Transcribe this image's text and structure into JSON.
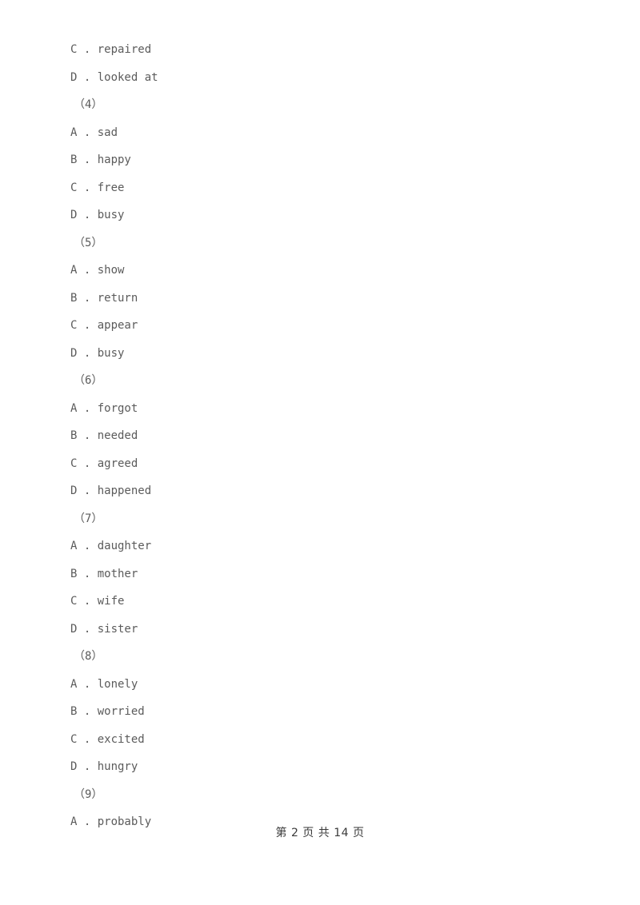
{
  "document": {
    "page_background": "#ffffff",
    "text_color": "#5b5b5b",
    "footer_color": "#3a3a3a"
  },
  "lines": [
    {
      "type": "option",
      "text": "C . repaired"
    },
    {
      "type": "option",
      "text": "D . looked at"
    },
    {
      "type": "qnum",
      "text": "（4）"
    },
    {
      "type": "option",
      "text": "A . sad"
    },
    {
      "type": "option",
      "text": "B . happy"
    },
    {
      "type": "option",
      "text": "C . free"
    },
    {
      "type": "option",
      "text": "D . busy"
    },
    {
      "type": "qnum",
      "text": "（5）"
    },
    {
      "type": "option",
      "text": "A . show"
    },
    {
      "type": "option",
      "text": "B . return"
    },
    {
      "type": "option",
      "text": "C . appear"
    },
    {
      "type": "option",
      "text": "D . busy"
    },
    {
      "type": "qnum",
      "text": "（6）"
    },
    {
      "type": "option",
      "text": "A . forgot"
    },
    {
      "type": "option",
      "text": "B . needed"
    },
    {
      "type": "option",
      "text": "C . agreed"
    },
    {
      "type": "option",
      "text": "D . happened"
    },
    {
      "type": "qnum",
      "text": "（7）"
    },
    {
      "type": "option",
      "text": "A . daughter"
    },
    {
      "type": "option",
      "text": "B . mother"
    },
    {
      "type": "option",
      "text": "C . wife"
    },
    {
      "type": "option",
      "text": "D . sister"
    },
    {
      "type": "qnum",
      "text": "（8）"
    },
    {
      "type": "option",
      "text": "A . lonely"
    },
    {
      "type": "option",
      "text": "B . worried"
    },
    {
      "type": "option",
      "text": "C . excited"
    },
    {
      "type": "option",
      "text": "D . hungry"
    },
    {
      "type": "qnum",
      "text": "（9）"
    },
    {
      "type": "option",
      "text": "A . probably"
    }
  ],
  "footer": {
    "text": "第 2 页 共 14 页",
    "current_page": "2",
    "total_pages": "14"
  }
}
